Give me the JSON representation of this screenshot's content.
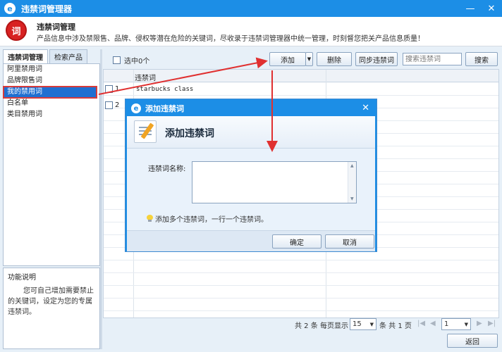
{
  "window": {
    "title": "违禁词管理器"
  },
  "header": {
    "logo_text": "词",
    "title": "违禁词管理",
    "description": "产品信息中涉及禁限售、品牌、侵权等潜在危险的关键词，尽收录于违禁词管理器中统一管理，时刻督您把关产品信息质量！"
  },
  "left": {
    "tabs": [
      {
        "label": "违禁词管理"
      },
      {
        "label": "检索产品"
      }
    ],
    "tree": [
      {
        "label": "阿里禁用词"
      },
      {
        "label": "品牌限售词"
      },
      {
        "label": "我的禁用词"
      },
      {
        "label": "白名单"
      },
      {
        "label": "类目禁用词"
      }
    ],
    "func_title": "功能说明",
    "func_text": "您可自己增加需要禁止的关键词，设定为您的专属违禁词。"
  },
  "toolbar": {
    "selected_text": "选中0个",
    "add_label": "添加",
    "delete_label": "删除",
    "sync_label": "同步违禁词",
    "search_placeholder": "搜索违禁词",
    "search_label": "搜索"
  },
  "grid": {
    "column": "违禁词",
    "rows": [
      {
        "num": "1",
        "word": "starbucks class"
      },
      {
        "num": "2",
        "word": ""
      }
    ]
  },
  "pager": {
    "total_text": "共 2 条",
    "per_page_text": "每页显示",
    "per_page_value": "15",
    "page_info": "条 共 1 页",
    "current_page": "1"
  },
  "return_label": "返回",
  "dialog": {
    "title": "添加违禁词",
    "banner_title": "添加违禁词",
    "field_label": "违禁词名称:",
    "field_value": "",
    "hint": "添加多个违禁词，一行一个违禁词。",
    "ok_label": "确定",
    "cancel_label": "取消"
  },
  "colors": {
    "accent": "#1c8ee6",
    "annotation": "#e03030",
    "selected": "#1f6fd1"
  }
}
